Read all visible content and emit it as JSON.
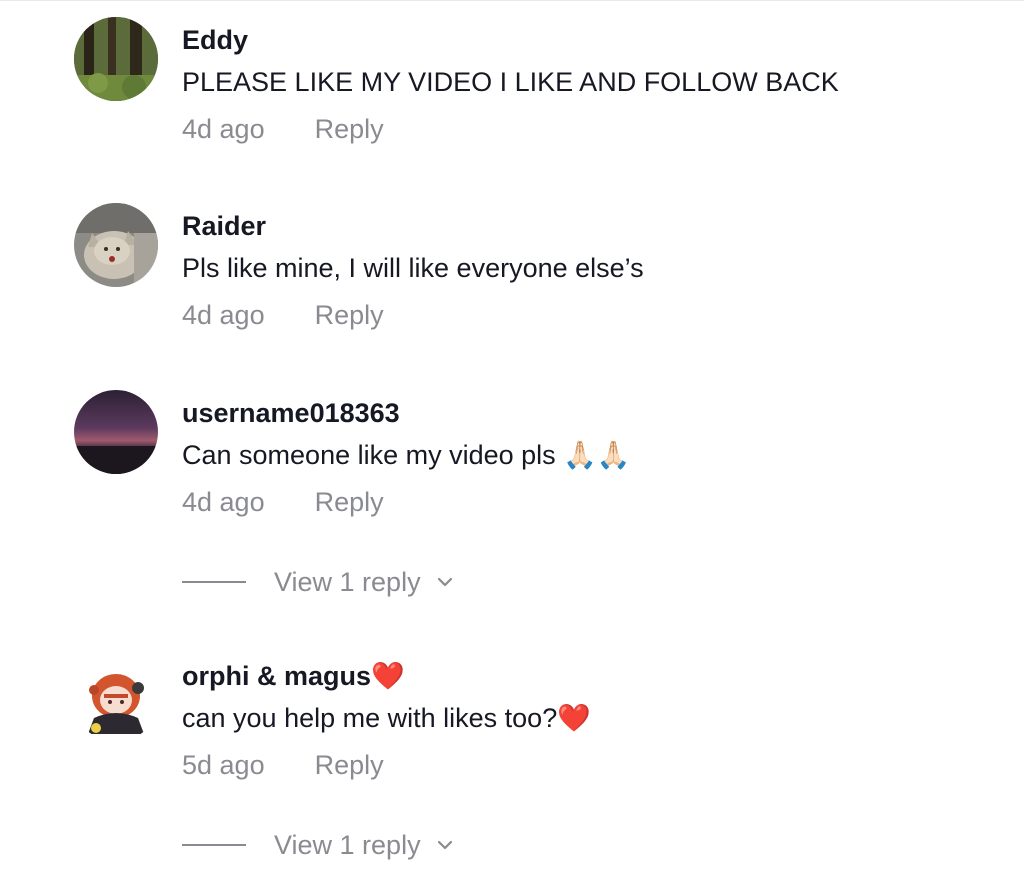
{
  "comments": [
    {
      "username": "Eddy",
      "text": "PLEASE LIKE MY VIDEO I LIKE AND FOLLOW BACK",
      "time": "4d ago",
      "reply_label": "Reply",
      "avatar_icon": "forest-avatar"
    },
    {
      "username": "Raider",
      "text": "Pls like mine, I will like everyone else’s",
      "time": "4d ago",
      "reply_label": "Reply",
      "avatar_icon": "cat-avatar"
    },
    {
      "username": "username018363",
      "text": "Can someone like my video pls 🙏🏻🙏🏻",
      "time": "4d ago",
      "reply_label": "Reply",
      "view_replies_label": "View 1 reply",
      "avatar_icon": "sunset-avatar"
    },
    {
      "username": "orphi & magus❤️",
      "text": "can you help me with likes too?❤️",
      "time": "5d ago",
      "reply_label": "Reply",
      "view_replies_label": "View 1 reply",
      "avatar_icon": "anime-avatar"
    }
  ],
  "colors": {
    "primary_text": "#161823",
    "secondary_text": "#8a8b91",
    "heart": "#fe2c55"
  }
}
